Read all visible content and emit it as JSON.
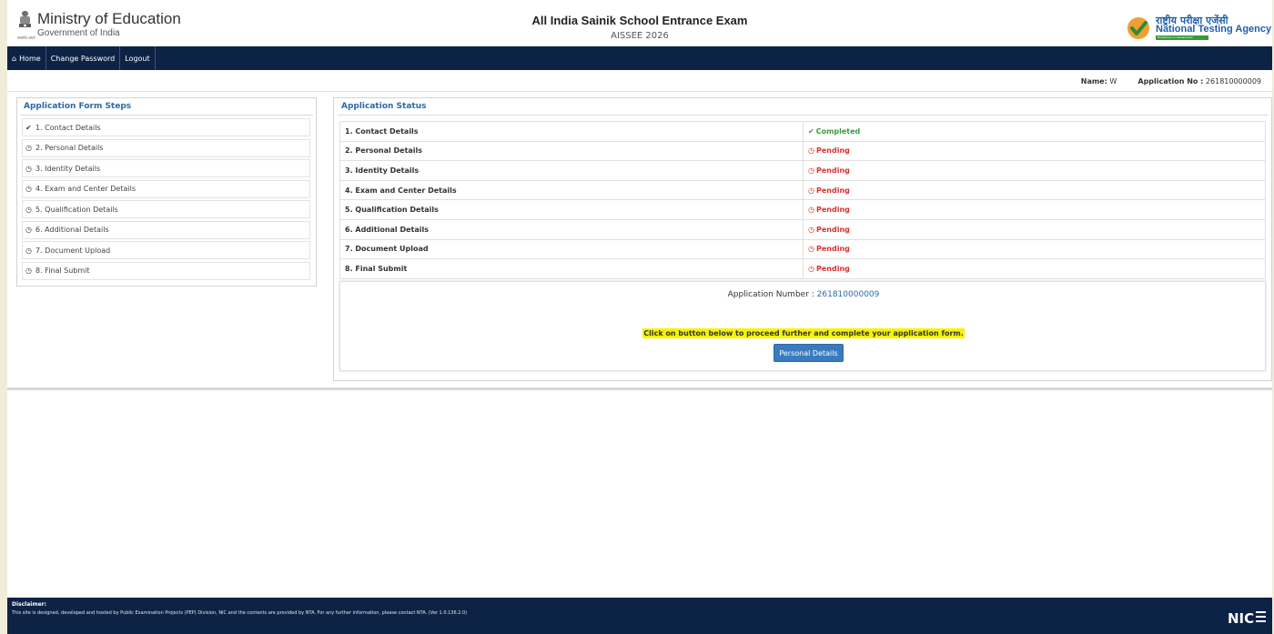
{
  "header": {
    "ministry_title": "Ministry of Education",
    "ministry_subtitle": "Government of India",
    "emblem_caption": "सत्यमेव जयते",
    "exam_title": "All India Sainik School Entrance Exam",
    "exam_code": "AISSEE 2026",
    "agency_hindi": "राष्ट्रीय परीक्षा एजेंसी",
    "agency_name": "National Testing Agency",
    "agency_tagline": "Excellence in Assessment"
  },
  "nav": {
    "home": "Home",
    "change_password": "Change Password",
    "logout": "Logout",
    "home_icon": "home-icon"
  },
  "user": {
    "name_label": "Name:",
    "name_value": "W",
    "app_label": "Application No :",
    "app_value": "261810000009"
  },
  "steps_panel": {
    "title": "Application Form Steps",
    "items": [
      {
        "label": "1. Contact Details",
        "icon": "check-circle-icon",
        "glyph": "✔"
      },
      {
        "label": "2. Personal Details",
        "icon": "clock-icon",
        "glyph": "◷"
      },
      {
        "label": "3. Identity Details",
        "icon": "clock-icon",
        "glyph": "◷"
      },
      {
        "label": "4. Exam and Center Details",
        "icon": "clock-icon",
        "glyph": "◷"
      },
      {
        "label": "5. Qualification Details",
        "icon": "clock-icon",
        "glyph": "◷"
      },
      {
        "label": "6. Additional Details",
        "icon": "clock-icon",
        "glyph": "◷"
      },
      {
        "label": "7. Document Upload",
        "icon": "clock-icon",
        "glyph": "◷"
      },
      {
        "label": "8. Final Submit",
        "icon": "clock-icon",
        "glyph": "◷"
      }
    ]
  },
  "status_panel": {
    "title": "Application Status",
    "rows": [
      {
        "step": "1. Contact Details",
        "status": "Completed",
        "state": "completed",
        "glyph": "✔"
      },
      {
        "step": "2. Personal Details",
        "status": "Pending",
        "state": "pending",
        "glyph": "◷"
      },
      {
        "step": "3. Identity Details",
        "status": "Pending",
        "state": "pending",
        "glyph": "◷"
      },
      {
        "step": "4. Exam and Center Details",
        "status": "Pending",
        "state": "pending",
        "glyph": "◷"
      },
      {
        "step": "5. Qualification Details",
        "status": "Pending",
        "state": "pending",
        "glyph": "◷"
      },
      {
        "step": "6. Additional Details",
        "status": "Pending",
        "state": "pending",
        "glyph": "◷"
      },
      {
        "step": "7. Document Upload",
        "status": "Pending",
        "state": "pending",
        "glyph": "◷"
      },
      {
        "step": "8. Final Submit",
        "status": "Pending",
        "state": "pending",
        "glyph": "◷"
      }
    ],
    "application_number_label": "Application Number :",
    "application_number": "261810000009",
    "instruction": "Click on button below to proceed further and complete your application form.",
    "button_label": "Personal Details"
  },
  "footer": {
    "disclaimer_title": "Disclaimer:",
    "disclaimer_text": "This site is designed, developed and hosted by Public Examination Projects (PEP) Division, NIC and the contents are provided by NTA. For any further information, please contact NTA. (Ver 1.0.136.2.0)",
    "nic_logo_text": "NIC"
  },
  "colors": {
    "navbar": "#0d2346",
    "accent_blue": "#2c6aa5",
    "completed": "#3c9a3c",
    "pending": "#d9302c",
    "highlight": "#f6f400",
    "page_bg": "#efecd8"
  }
}
